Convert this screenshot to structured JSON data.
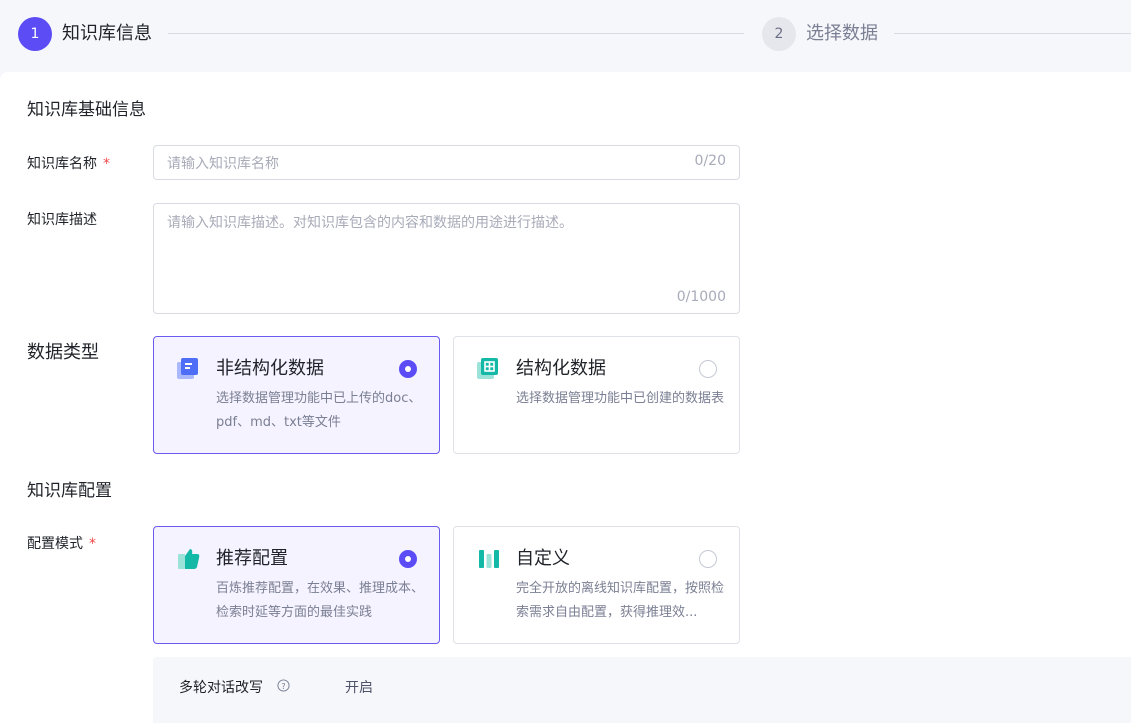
{
  "steps": [
    {
      "number": "1",
      "label": "知识库信息",
      "active": true
    },
    {
      "number": "2",
      "label": "选择数据",
      "active": false
    }
  ],
  "basic_info": {
    "title": "知识库基础信息",
    "name_label": "知识库名称",
    "required_mark": "*",
    "name_placeholder": "请输入知识库名称",
    "name_count": "0/20",
    "desc_label": "知识库描述",
    "desc_placeholder": "请输入知识库描述。对知识库包含的内容和数据的用途进行描述。",
    "desc_count": "0/1000"
  },
  "data_type": {
    "label": "数据类型",
    "options": [
      {
        "title": "非结构化数据",
        "desc": "选择数据管理功能中已上传的doc、pdf、md、txt等文件",
        "selected": true,
        "icon": "document-icon"
      },
      {
        "title": "结构化数据",
        "desc": "选择数据管理功能中已创建的数据表",
        "selected": false,
        "icon": "table-icon"
      }
    ]
  },
  "config": {
    "title": "知识库配置",
    "mode_label": "配置模式",
    "required_mark": "*",
    "options": [
      {
        "title": "推荐配置",
        "desc": "百炼推荐配置，在效果、推理成本、检索时延等方面的最佳实践",
        "selected": true,
        "icon": "thumbs-up-icon"
      },
      {
        "title": "自定义",
        "desc": "完全开放的离线知识库配置，按照检索需求自由配置，获得推理效...",
        "selected": false,
        "icon": "custom-bars-icon"
      }
    ],
    "multi_turn_label": "多轮对话改写",
    "multi_turn_value": "开启"
  },
  "colors": {
    "accent": "#5b4cf6",
    "doc_icon": "#4f6ef7",
    "teal_icon": "#14b8a6",
    "required": "#f04848"
  }
}
